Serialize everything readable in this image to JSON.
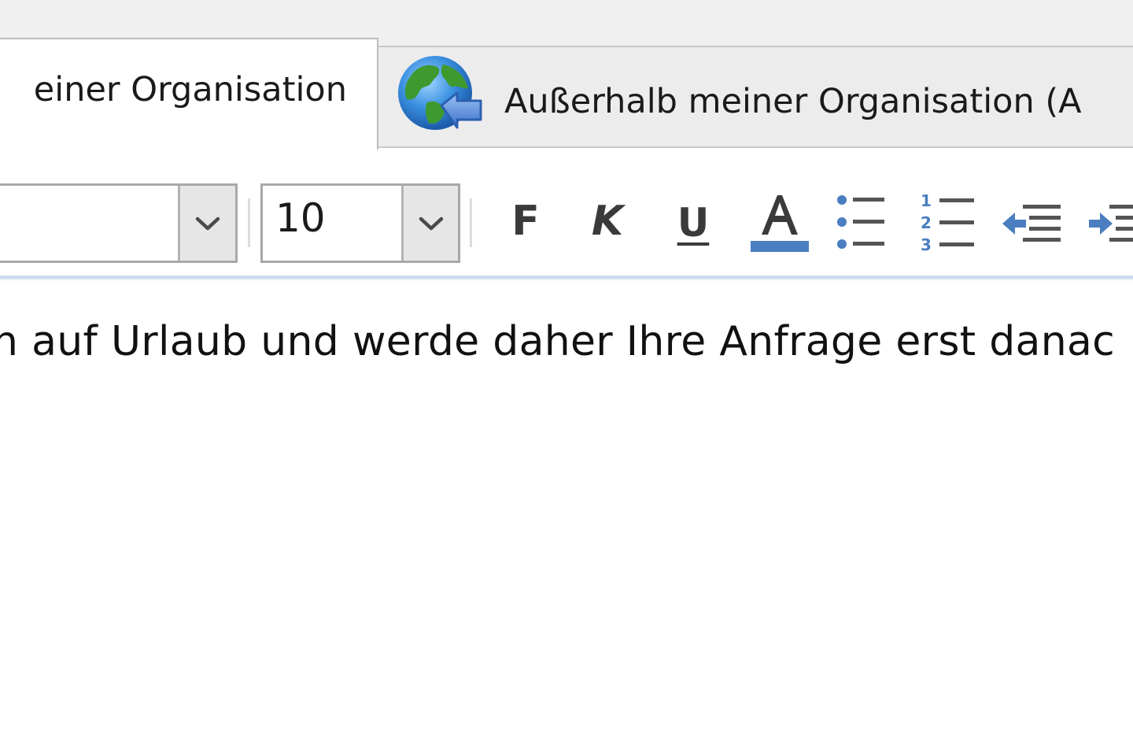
{
  "tabs": {
    "inside_label": "einer Organisation",
    "outside_label": "Außerhalb meiner Organisation (A"
  },
  "toolbar": {
    "font_name": "",
    "font_size": "10",
    "bold_label": "F",
    "italic_label": "K",
    "underline_label": "U",
    "font_color_label": "A",
    "font_color": "#4a7ec0"
  },
  "message": {
    "body_text": "n auf Urlaub und werde daher Ihre Anfrage erst danac"
  },
  "colors": {
    "accent": "#4a7ec0",
    "tab_inactive_bg": "#ececec",
    "toolbar_rule": "#c9d9ee"
  }
}
